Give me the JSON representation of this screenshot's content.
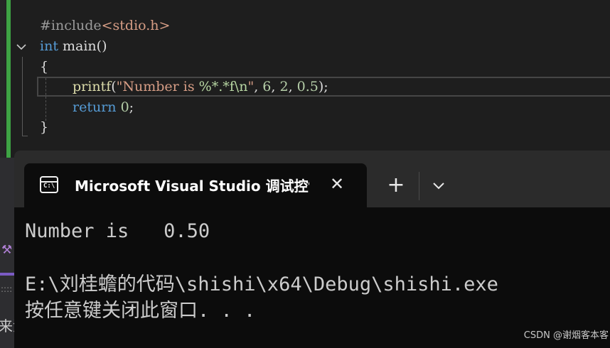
{
  "editor": {
    "line1": {
      "directive": "#include",
      "header": "<stdio.h>"
    },
    "line2": {
      "type": "int",
      "name": "main",
      "parens": "()"
    },
    "line3": {
      "text": "{"
    },
    "line4": {
      "func": "printf",
      "open": "(",
      "str_start": "\"Number is ",
      "fmt": "%*.*f\\n",
      "str_end": "\"",
      "args_sep1": ", ",
      "arg1": "6",
      "args_sep2": ", ",
      "arg2": "2",
      "args_sep3": ", ",
      "arg3": "0.5",
      "close": ");"
    },
    "line5": {
      "keyword": "return",
      "value": "0",
      "end": ";"
    },
    "line6": {
      "text": "}"
    }
  },
  "background": {
    "partial_text": "来源",
    "dots": "::::"
  },
  "terminal": {
    "tab_title": "Microsoft Visual Studio 调试控制台",
    "icon_prompt": "C:\\",
    "close_glyph": "✕",
    "new_tab_glyph": "+",
    "output": [
      "Number is   0.50",
      "",
      "E:\\刘桂蟾的代码\\shishi\\x64\\Debug\\shishi.exe",
      "按任意键关闭此窗口. . ."
    ]
  },
  "watermark": "CSDN @谢烟客本客",
  "colors": {
    "keyword": "#569cd6",
    "string": "#d69d85",
    "format_escape": "#b8d7a3",
    "number": "#b5cea8",
    "function": "#dcdcaa",
    "change_bar": "#3ea344"
  }
}
